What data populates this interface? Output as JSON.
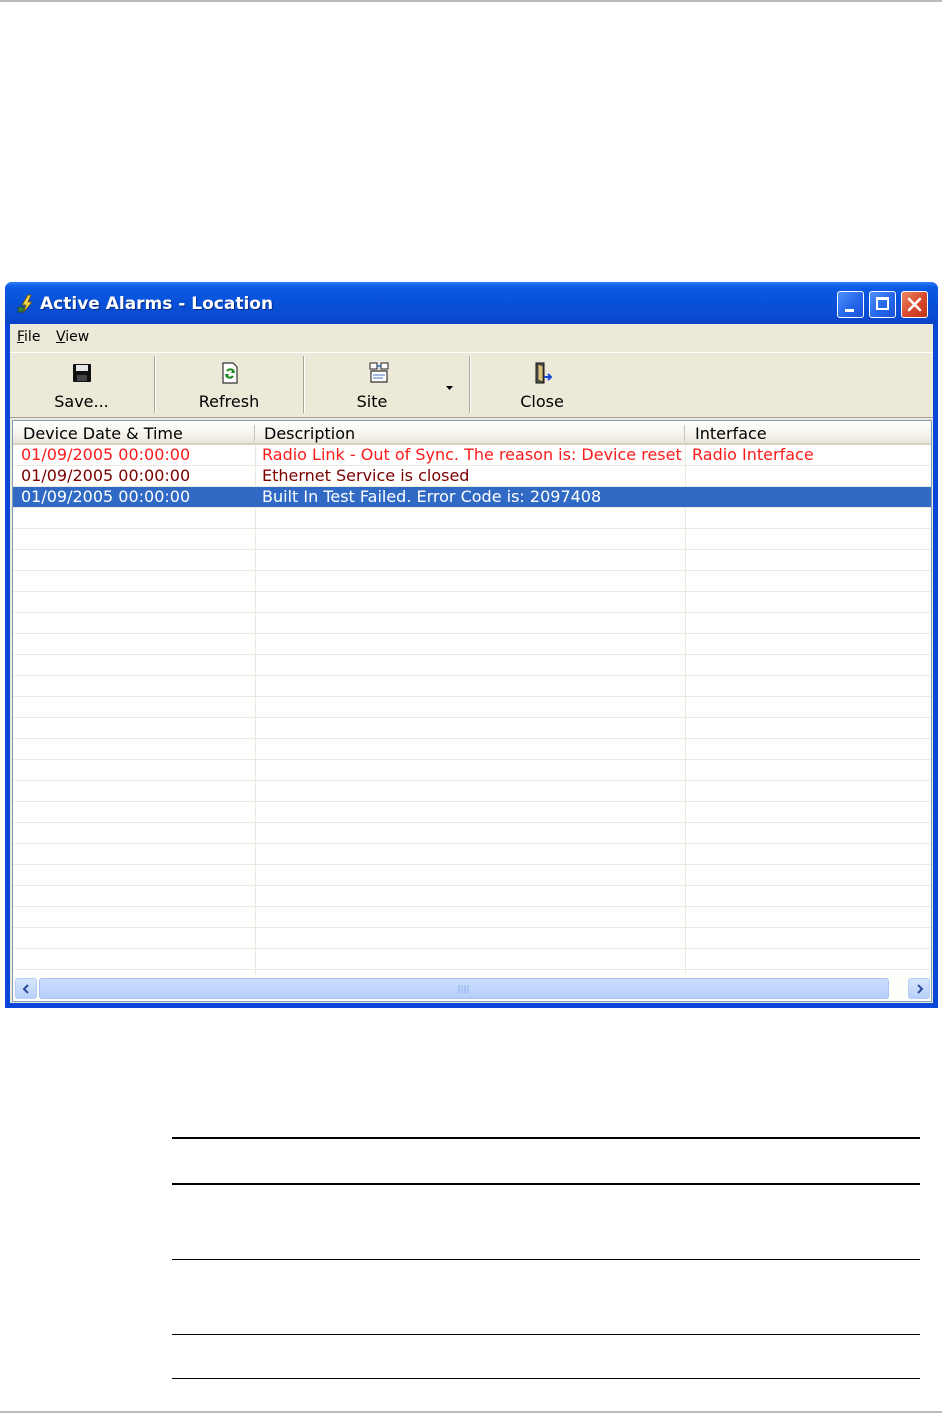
{
  "window": {
    "title": "Active Alarms - Location"
  },
  "menu": {
    "file_key": "F",
    "file_rest": "ile",
    "view_key": "V",
    "view_rest": "iew"
  },
  "toolbar": {
    "save_label": "Save...",
    "refresh_label": "Refresh",
    "site_label": "Site",
    "close_label": "Close"
  },
  "table": {
    "columns": [
      "Device Date & Time",
      "Description",
      "Interface"
    ],
    "rows": [
      {
        "datetime": "01/09/2005 00:00:00",
        "description": "Radio Link - Out of Sync. The reason is: Device reset",
        "interface": "Radio Interface",
        "color": "#ff1a1a"
      },
      {
        "datetime": "01/09/2005 00:00:00",
        "description": "Ethernet Service is closed",
        "interface": "",
        "color": "#7a0000"
      },
      {
        "datetime": "01/09/2005 00:00:00",
        "description": "Built In Test Failed. Error Code is: 2097408",
        "interface": "",
        "color": "#ffffff",
        "selected": true
      }
    ]
  },
  "colors": {
    "title_bar": "#0a47d8",
    "selection": "#316ac5",
    "critical_text": "#ff1a1a"
  }
}
